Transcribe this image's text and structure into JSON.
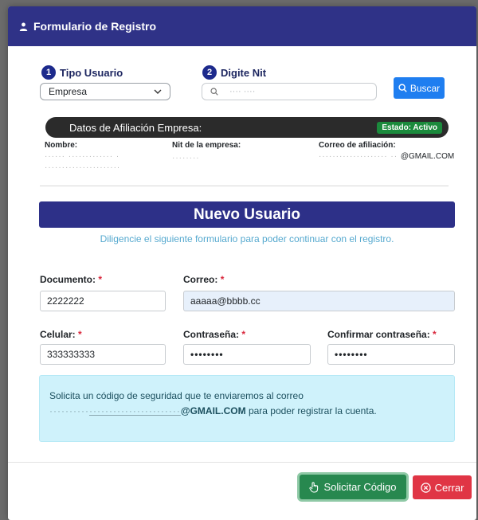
{
  "modal": {
    "title": "Formulario de Registro"
  },
  "step1": {
    "number": "1",
    "label": "Tipo Usuario",
    "select_value": "Empresa"
  },
  "step2": {
    "number": "2",
    "label": "Digite Nit",
    "input_value": "···· ····"
  },
  "search_button": "Buscar",
  "afiliacion": {
    "title": "Datos de Afiliación Empresa:",
    "status": "Estado: Activo",
    "nombre_label": "Nombre:",
    "nombre_value": "······ ············· ·",
    "nombre_value_2": "······················",
    "nit_label": "Nit de la empresa:",
    "nit_value": "········",
    "correo_label": "Correo de afiliación:",
    "correo_value": "@GMAIL.COM"
  },
  "nuevo_usuario": {
    "title": "Nuevo Usuario",
    "subtitle": "Diligencie el siguiente formulario para poder continuar con el registro."
  },
  "form": {
    "documento_label": "Documento:",
    "documento_value": "2222222",
    "correo_label": "Correo:",
    "correo_value": "aaaaa@bbbb.cc",
    "celular_label": "Celular:",
    "celular_value": "333333333",
    "password_label": "Contraseña:",
    "password_value": "••••••••",
    "confirm_label": "Confirmar contraseña:",
    "confirm_value": "••••••••",
    "required_mark": "*"
  },
  "alert": {
    "text_1": "Solicita un código de seguridad que te enviaremos al correo",
    "email": "@GMAIL.COM",
    "text_2": "para poder registrar la cuenta."
  },
  "footer": {
    "request_code": "Solicitar Código",
    "close": "Cerrar"
  },
  "colors": {
    "header": "#2f3287",
    "primary": "#1f7ef0",
    "success": "#27884f",
    "danger": "#e03545",
    "alert_bg": "#cff2fb"
  }
}
